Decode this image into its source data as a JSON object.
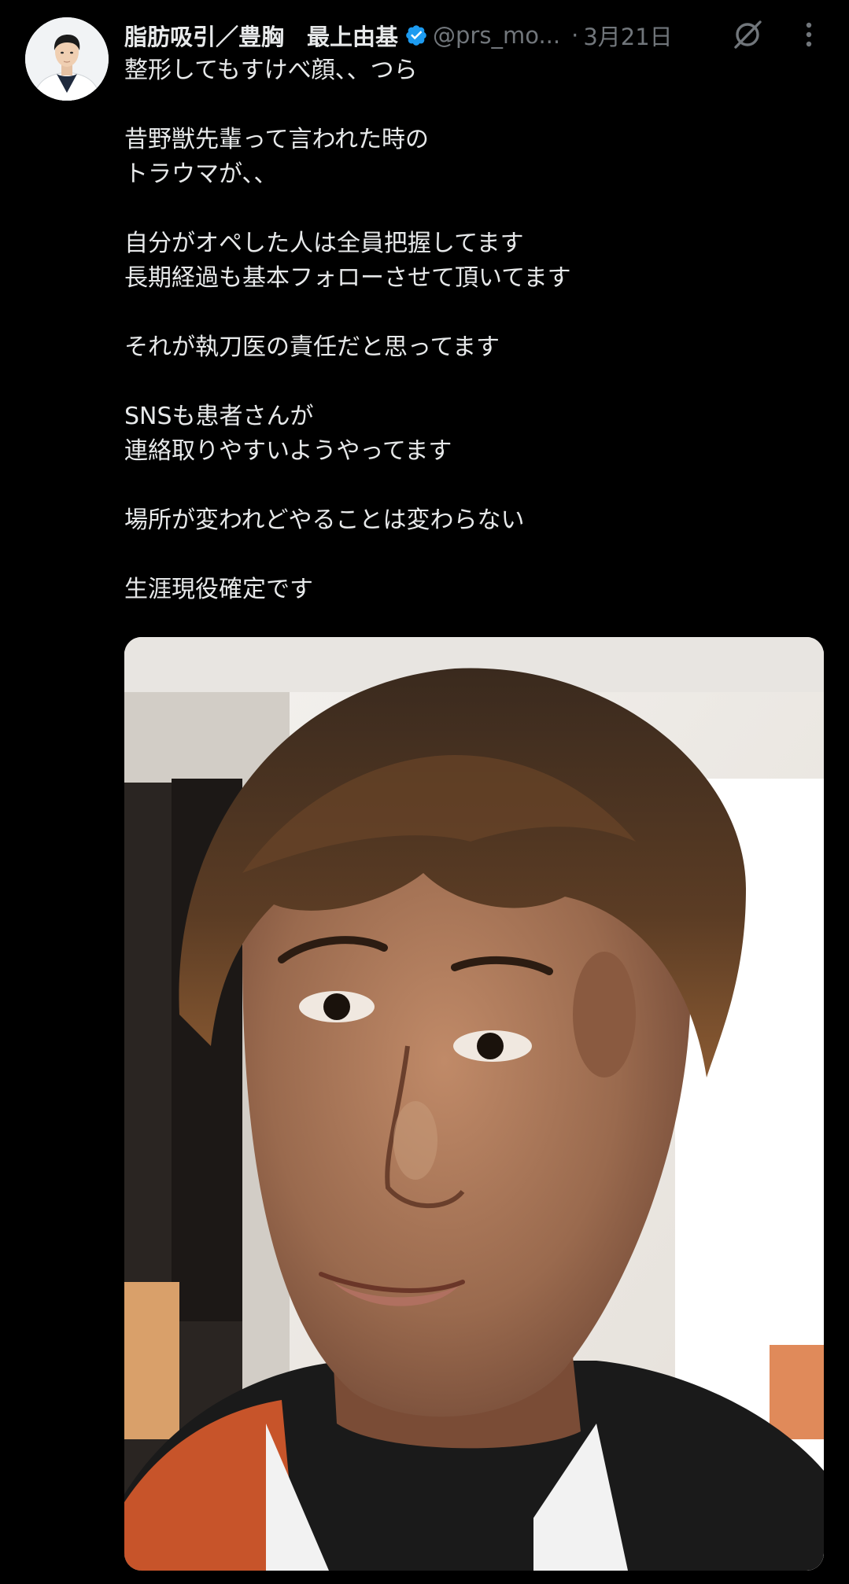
{
  "author": {
    "display_name": "脂肪吸引／豊胸　最上由基",
    "handle": "@prs_mo...",
    "date": "3月21日",
    "verified": true,
    "verified_color": "#1d9bf0",
    "avatar_icon": "doctor-avatar-icon"
  },
  "header_actions": {
    "separator": "·",
    "grok_icon": "grok-icon",
    "more_icon": "more-dots-icon"
  },
  "tweet": {
    "paragraphs": [
      "整形してもすけべ顔、、つら",
      "",
      "昔野獣先輩って言われた時の",
      "トラウマが、、",
      "",
      "自分がオペした人は全員把握してます",
      "長期経過も基本フォローさせて頂いてます",
      "",
      "それが執刀医の責任だと思ってます",
      "",
      "SNSも患者さんが",
      "連絡取りやすいようやってます",
      "",
      "場所が変われどやることは変わらない",
      "",
      "生涯現役確定です"
    ]
  },
  "media": {
    "type": "photo",
    "subject": "selfie-photo"
  },
  "colors": {
    "background": "#000000",
    "text_primary": "#e7e9ea",
    "text_secondary": "#71767b",
    "accent": "#1d9bf0"
  }
}
